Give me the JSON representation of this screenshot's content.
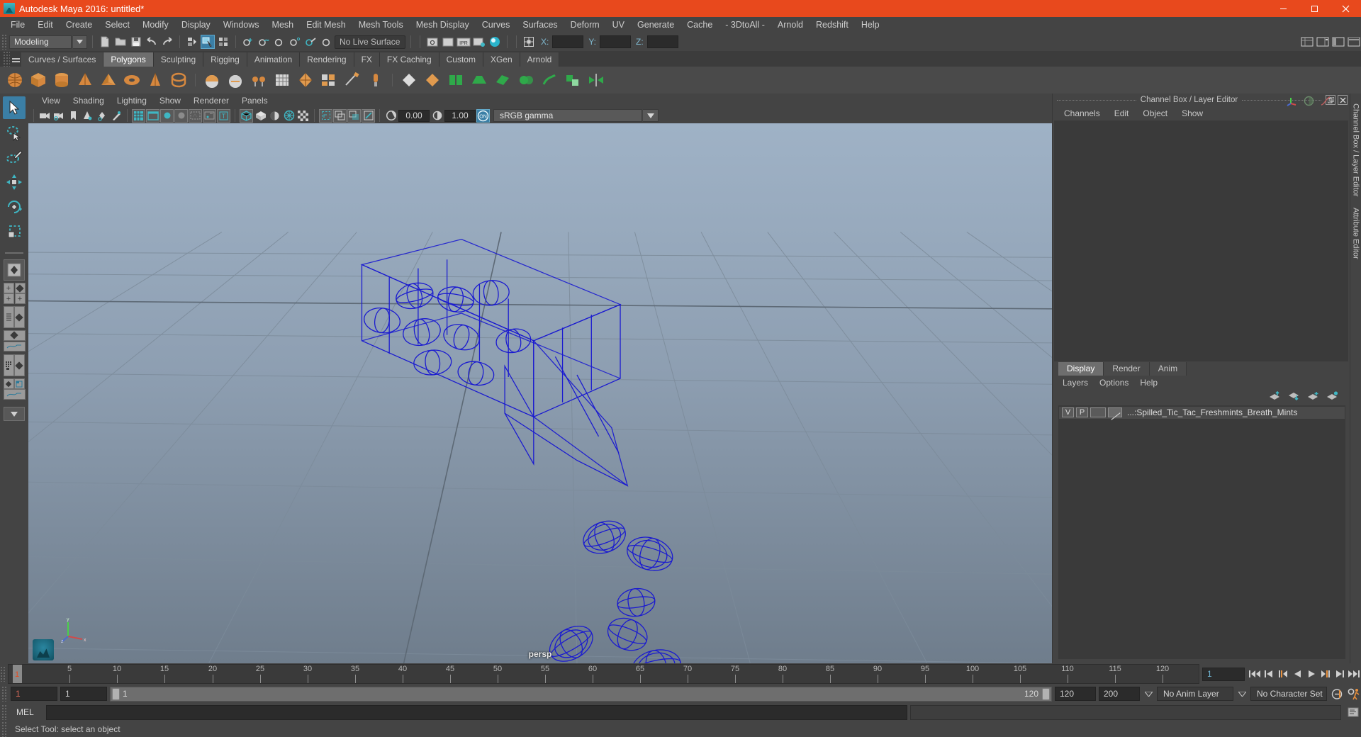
{
  "window": {
    "title": "Autodesk Maya 2016: untitled*",
    "logo_icon": "maya-logo-icon",
    "minimize_label": "minimize-icon",
    "maximize_label": "maximize-icon",
    "close_label": "close-icon"
  },
  "menubar": {
    "items": [
      "File",
      "Edit",
      "Create",
      "Select",
      "Modify",
      "Display",
      "Windows",
      "Mesh",
      "Edit Mesh",
      "Mesh Tools",
      "Mesh Display",
      "Curves",
      "Surfaces",
      "Deform",
      "UV",
      "Generate",
      "Cache",
      "- 3DtoAll -",
      "Arnold",
      "Redshift",
      "Help"
    ]
  },
  "statusline": {
    "mode": "Modeling",
    "live_surface": "No Live Surface",
    "coord_x_label": "X:",
    "coord_y_label": "Y:",
    "coord_z_label": "Z:",
    "coord_x_value": "",
    "coord_y_value": "",
    "coord_z_value": "",
    "icons": [
      "new-scene-icon",
      "open-scene-icon",
      "save-scene-icon",
      "undo-icon",
      "redo-icon",
      "select-by-hierarchy-icon",
      "select-by-object-icon",
      "select-by-component-icon",
      "snap-to-grid-icon",
      "snap-to-curve-icon",
      "snap-to-point-icon",
      "snap-to-projected-center-icon",
      "snap-to-view-plane-icon",
      "make-live-icon",
      "render-view-icon",
      "render-current-frame-icon",
      "ipr-render-icon",
      "render-settings-icon",
      "hypershade-icon",
      "sidebar-toggle-icon",
      "show-channel-box-icon",
      "show-attribute-editor-icon",
      "show-tool-settings-icon"
    ]
  },
  "shelf": {
    "tabs": [
      "Curves / Surfaces",
      "Polygons",
      "Sculpting",
      "Rigging",
      "Animation",
      "Rendering",
      "FX",
      "FX Caching",
      "Custom",
      "XGen",
      "Arnold"
    ],
    "active_tab": "Polygons",
    "icons": [
      "poly-sphere-icon",
      "poly-cube-icon",
      "poly-cylinder-icon",
      "poly-cone-icon",
      "poly-pyramid-icon",
      "poly-torus-icon",
      "poly-prism-icon",
      "poly-pipe-icon",
      "poly-helix-icon",
      "poly-soccer-ball-icon",
      "poly-platonic-icon",
      "poly-plane-icon",
      "poly-disc-icon",
      "poly-super-shape-icon",
      "poly-gear-icon",
      "sculpt-icon",
      "quad-draw-icon",
      "multi-cut-icon",
      "bevel-icon",
      "bridge-icon",
      "extrude-icon",
      "combine-icon",
      "separate-icon",
      "booleans-union-icon",
      "booleans-difference-icon",
      "booleans-intersection-icon",
      "mirror-icon",
      "smooth-icon",
      "reduce-icon",
      "retopologize-icon"
    ]
  },
  "toolbox": {
    "tools": [
      "select-tool",
      "lasso-select-tool",
      "paint-select-tool",
      "move-tool",
      "rotate-tool",
      "scale-tool"
    ],
    "active_tool": "select-tool",
    "layouts": [
      "single-perspective-layout",
      "four-view-layout",
      "outliner-persp-layout",
      "persp-graph-layout",
      "hypershade-persp-layout",
      "persp-graph-outliner-layout"
    ]
  },
  "viewport": {
    "menu": [
      "View",
      "Shading",
      "Lighting",
      "Show",
      "Renderer",
      "Panels"
    ],
    "camera_label": "persp",
    "exposure_value": "0.00",
    "gamma_value": "1.00",
    "color_management": "sRGB gamma",
    "toolbar_icons": [
      "select-camera-icon",
      "camera-attributes-icon",
      "bookmark-icon",
      "image-plane-icon",
      "2d-pan-zoom-icon",
      "grease-pencil-icon",
      "grid-toggle-icon",
      "film-gate-icon",
      "resolution-gate-icon",
      "gate-mask-icon",
      "field-chart-icon",
      "safe-action-icon",
      "safe-title-icon",
      "wireframe-icon",
      "smooth-shade-icon",
      "shade-and-texture-icon",
      "use-all-lights-icon",
      "shadows-icon",
      "screen-space-ao-icon",
      "motion-blur-icon",
      "multisample-aa-icon",
      "depth-of-field-icon",
      "isolate-select-icon",
      "xray-icon",
      "xray-joints-icon",
      "exposure-icon",
      "gamma-icon",
      "color-management-on-icon"
    ],
    "gizmo_axes": [
      "x",
      "y",
      "z"
    ]
  },
  "channel_box": {
    "panel_title": "Channel Box / Layer Editor",
    "menu": [
      "Channels",
      "Edit",
      "Object",
      "Show"
    ],
    "float_icon": "float-panel-icon",
    "close_icon": "close-panel-icon",
    "header_icons": [
      "axis-gizmo-icon",
      "shading-sphere-icon",
      "curve-icon"
    ]
  },
  "layer_editor": {
    "tabs": [
      "Display",
      "Render",
      "Anim"
    ],
    "active_tab": "Display",
    "menu": [
      "Layers",
      "Options",
      "Help"
    ],
    "toolbar_icons": [
      "move-layer-up-icon",
      "move-layer-down-icon",
      "new-layer-icon",
      "new-layer-from-selected-icon"
    ],
    "layers": [
      {
        "visibility": "V",
        "playback": "P",
        "shading": "",
        "color_swatch": "",
        "name": "...:Spilled_Tic_Tac_Freshmints_Breath_Mints"
      }
    ]
  },
  "right_strip": {
    "tabs": [
      "Channel Box / Layer Editor",
      "Attribute Editor"
    ]
  },
  "timeslider": {
    "current_frame": "1",
    "current_frame_field": "1",
    "ticks": [
      5,
      10,
      15,
      20,
      25,
      30,
      35,
      40,
      45,
      50,
      55,
      60,
      65,
      70,
      75,
      80,
      85,
      90,
      95,
      100,
      105,
      110,
      115,
      120
    ],
    "end_label": "120",
    "playback_icons": [
      "go-to-start-icon",
      "step-back-frame-icon",
      "step-back-key-icon",
      "play-backwards-icon",
      "play-forwards-icon",
      "step-forward-key-icon",
      "step-forward-frame-icon",
      "go-to-end-icon"
    ]
  },
  "rangeslider": {
    "anim_start": "1",
    "range_start": "1",
    "bar_start_label": "1",
    "bar_end_label": "120",
    "range_end": "120",
    "anim_end": "200",
    "anim_layer": "No Anim Layer",
    "character_set": "No Character Set",
    "auto_key_icon": "auto-keyframe-icon",
    "anim_prefs_icon": "animation-preferences-icon"
  },
  "commandline": {
    "language_label": "MEL",
    "input_value": "",
    "output_value": "",
    "script_editor_icon": "script-editor-icon"
  },
  "helpline": {
    "text": "Select Tool: select an object"
  },
  "colors": {
    "title_bar": "#e8491d",
    "panel_bg": "#444444",
    "accent_blue": "#3b7fa6",
    "wireframe_blue": "#1a1ad0",
    "shelf_orange": "#d6883f",
    "icon_teal": "#3fb7c4"
  }
}
